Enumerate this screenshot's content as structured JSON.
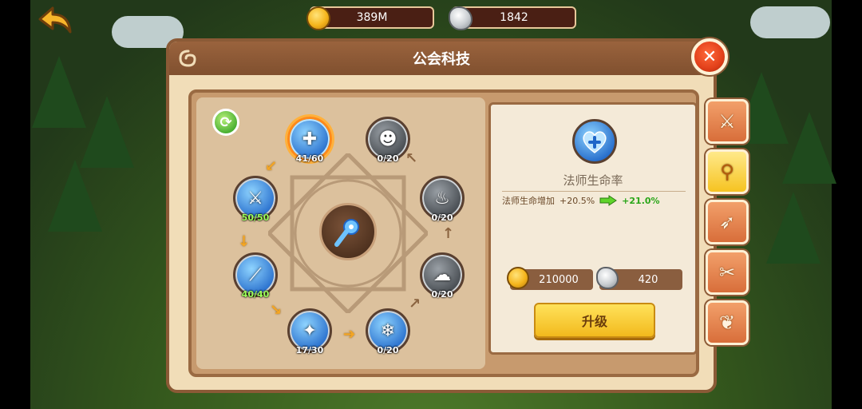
{
  "resources": {
    "gold": "389M",
    "stone": "1842"
  },
  "panel": {
    "title": "公会科技",
    "close_symbol": "✕"
  },
  "tech_nodes": [
    {
      "name": "mage-hp-heart",
      "label": "41/60",
      "active": true,
      "unlocked": true
    },
    {
      "name": "sword-shield",
      "label": "50/50",
      "unlocked": true
    },
    {
      "name": "blade-strike",
      "label": "40/40",
      "unlocked": true
    },
    {
      "name": "whirlwind",
      "label": "17/30",
      "unlocked": true
    },
    {
      "name": "frost-field",
      "label": "0/20",
      "unlocked": true
    },
    {
      "name": "shadow-dash",
      "label": "0/20",
      "unlocked": false
    },
    {
      "name": "dark-flame",
      "label": "0/20",
      "unlocked": false
    },
    {
      "name": "ghost-figure",
      "label": "0/20",
      "unlocked": false
    }
  ],
  "detail": {
    "title": "法师生命率",
    "stat_name": "法师生命增加",
    "stat_current": "+20.5%",
    "stat_next": "+21.0%",
    "cost_gold": "210000",
    "cost_stone": "420",
    "upgrade_label": "升级"
  },
  "side_tabs": [
    {
      "name": "warrior",
      "selected": false
    },
    {
      "name": "mage",
      "selected": true
    },
    {
      "name": "archer",
      "selected": false
    },
    {
      "name": "rogue",
      "selected": false
    },
    {
      "name": "wings",
      "selected": false
    }
  ]
}
